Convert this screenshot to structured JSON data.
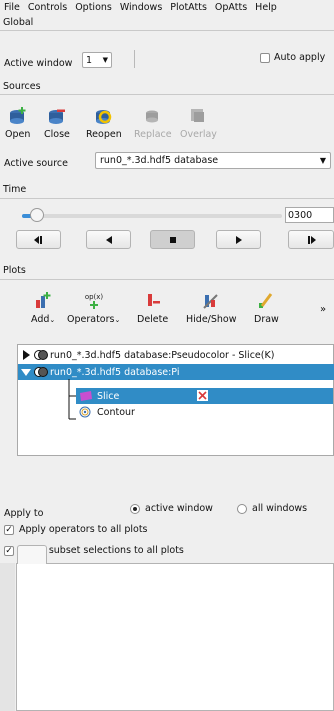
{
  "menu": [
    "File",
    "Controls",
    "Options",
    "Windows",
    "PlotAtts",
    "OpAtts",
    "Help"
  ],
  "global": {
    "label": "Global",
    "active_window_label": "Active window",
    "active_window_value": "1",
    "auto_apply_label": "Auto apply"
  },
  "sources": {
    "label": "Sources",
    "tools": [
      {
        "label": "Open",
        "enabled": true
      },
      {
        "label": "Close",
        "enabled": true
      },
      {
        "label": "Reopen",
        "enabled": true
      },
      {
        "label": "Replace",
        "enabled": false
      },
      {
        "label": "Overlay",
        "enabled": false
      }
    ],
    "active_source_label": "Active source",
    "active_source_value": "run0_*.3d.hdf5 database"
  },
  "time": {
    "label": "Time",
    "value": "0300",
    "slider_fraction": 0.05
  },
  "plots": {
    "label": "Plots",
    "tools": [
      {
        "label": "Add"
      },
      {
        "label": "Operators"
      },
      {
        "label": "Delete"
      },
      {
        "label": "Hide/Show"
      },
      {
        "label": "Draw"
      }
    ],
    "more": "»",
    "tree": [
      {
        "text": "run0_*.3d.hdf5 database:Pseudocolor - Slice(K)"
      },
      {
        "text": "run0_*.3d.hdf5 database:Pi"
      },
      {
        "text": "Slice"
      },
      {
        "text": "Contour"
      }
    ]
  },
  "apply_to": {
    "label": "Apply to",
    "active_window": "active window",
    "all_windows": "all windows",
    "apply_operators": "Apply operators to all plots",
    "apply_subset": "Apply subset selections to all plots"
  },
  "colors": {
    "selection": "#308cc6",
    "background": "#efefef"
  }
}
